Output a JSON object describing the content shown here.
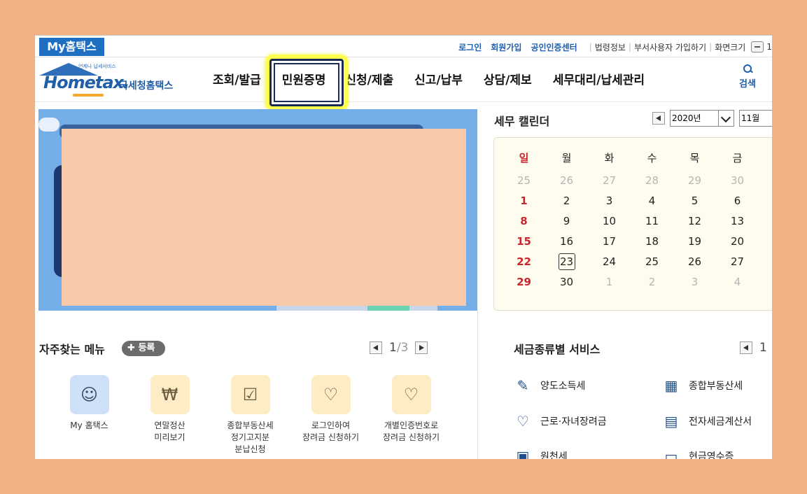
{
  "topbar": {
    "my_tab": "My홈택스",
    "links": [
      "로그인",
      "회원가입",
      "공인인증센터"
    ],
    "plain_links": [
      "법령정보",
      "부서사용자 가입하기",
      "화면크기"
    ],
    "zoom_value": "1"
  },
  "header": {
    "logo_sub": "언제나 납세서비스",
    "logo_word": "Hometax.",
    "logo_kr": "국세청홈택스",
    "nav": [
      "조회/발급",
      "민원증명",
      "신청/제출",
      "신고/납부",
      "상담/제보",
      "세무대리/납세관리"
    ],
    "highlighted_nav": "민원증명",
    "search_label": "검색",
    "colors": {
      "brand": "#1e6fc2",
      "highlight": "#ffff4d"
    }
  },
  "calendar": {
    "title": "세무 캘린더",
    "year": "2020년",
    "month": "11월",
    "weekdays": [
      "일",
      "월",
      "화",
      "수",
      "목",
      "금"
    ],
    "weeks": [
      [
        "25",
        "26",
        "27",
        "28",
        "29",
        "30"
      ],
      [
        "1",
        "2",
        "3",
        "4",
        "5",
        "6"
      ],
      [
        "8",
        "9",
        "10",
        "11",
        "12",
        "13"
      ],
      [
        "15",
        "16",
        "17",
        "18",
        "19",
        "20"
      ],
      [
        "22",
        "23",
        "24",
        "25",
        "26",
        "27"
      ],
      [
        "29",
        "30",
        "1",
        "2",
        "3",
        "4"
      ]
    ],
    "today": "23"
  },
  "favorites": {
    "title": "자주찾는 메뉴",
    "register_label": "등록",
    "page_current": "1",
    "page_total": "/3",
    "items": [
      {
        "icon": "person-icon",
        "lines": [
          "My 홈택스"
        ]
      },
      {
        "icon": "money-bag-icon",
        "lines": [
          "연말정산",
          "미리보기"
        ]
      },
      {
        "icon": "calendar-check-icon",
        "lines": [
          "종합부동산세",
          "정기고지분",
          "분납신청"
        ]
      },
      {
        "icon": "heart-plant-icon",
        "lines": [
          "로그인하여",
          "장려금 신청하기"
        ]
      },
      {
        "icon": "heart-plant-icon",
        "lines": [
          "개별인증번호로",
          "장려금 신청하기"
        ]
      }
    ]
  },
  "tax_services": {
    "title": "세금종류별 서비스",
    "page_current": "1",
    "items": [
      {
        "icon": "document-pen-icon",
        "label": "양도소득세"
      },
      {
        "icon": "building-icon",
        "label": "종합부동산세"
      },
      {
        "icon": "heart-plant-icon",
        "label": "근로·자녀장려금"
      },
      {
        "icon": "invoice-icon",
        "label": "전자세금계산서"
      },
      {
        "icon": "salary-doc-icon",
        "label": "원천세"
      },
      {
        "icon": "receipt-icon",
        "label": "현금영수증"
      }
    ]
  }
}
